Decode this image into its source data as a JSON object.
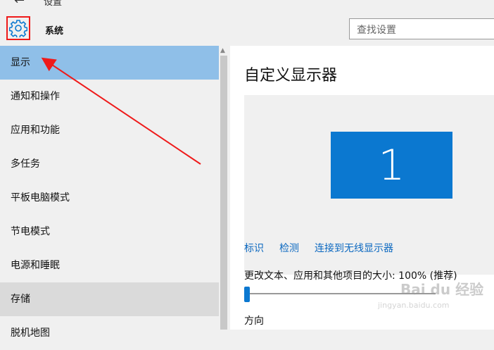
{
  "window": {
    "back_arrow": "←",
    "title": "设置"
  },
  "header": {
    "section_title": "系统",
    "search_placeholder": "查找设置"
  },
  "sidebar": {
    "items": [
      {
        "label": "显示"
      },
      {
        "label": "通知和操作"
      },
      {
        "label": "应用和功能"
      },
      {
        "label": "多任务"
      },
      {
        "label": "平板电脑模式"
      },
      {
        "label": "节电模式"
      },
      {
        "label": "电源和睡眠"
      },
      {
        "label": "存储"
      },
      {
        "label": "脱机地图"
      }
    ],
    "selected_index": 0
  },
  "content": {
    "title": "自定义显示器",
    "monitor_number": "1",
    "links": {
      "identify": "标识",
      "detect": "检测",
      "connect_wireless": "连接到无线显示器"
    },
    "scale_label": "更改文本、应用和其他项目的大小: 100% (推荐)",
    "scale_value_fraction": 0.0,
    "orientation_label": "方向"
  },
  "watermark": {
    "brand": "Bai du 经验",
    "url": "jingyan.baidu.com"
  },
  "colors": {
    "accent": "#0b78d0",
    "selected_bg": "#8fbfe8",
    "annotation": "#ef1a1a",
    "link": "#0b68c0"
  },
  "icons": {
    "settings": "gear-icon",
    "back": "back-arrow-icon"
  }
}
